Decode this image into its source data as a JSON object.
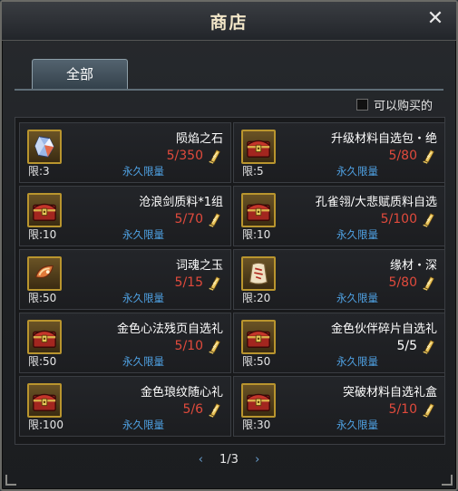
{
  "window": {
    "title": "商店",
    "close_icon": "close-icon"
  },
  "tabs": [
    {
      "label": "全部",
      "active": true
    }
  ],
  "filter": {
    "label": "可以购买的",
    "checked": false
  },
  "items": [
    {
      "name": "陨焰之石",
      "price": "5/350",
      "limit": "限:3",
      "tag": "永久限量",
      "icon": "crystal-icon",
      "affordable": false
    },
    {
      "name": "升级材料自选包・绝",
      "price": "5/80",
      "limit": "限:5",
      "tag": "永久限量",
      "icon": "chest-icon",
      "affordable": false
    },
    {
      "name": "沧浪剑质料*1组",
      "price": "5/70",
      "limit": "限:10",
      "tag": "永久限量",
      "icon": "chest-icon",
      "affordable": false
    },
    {
      "name": "孔雀翎/大悲赋质料自选",
      "price": "5/100",
      "limit": "限:10",
      "tag": "永久限量",
      "icon": "chest-icon",
      "affordable": false
    },
    {
      "name": "词魂之玉",
      "price": "5/15",
      "limit": "限:50",
      "tag": "永久限量",
      "icon": "jade-icon",
      "affordable": false
    },
    {
      "name": "缘材・深",
      "price": "5/80",
      "limit": "限:20",
      "tag": "永久限量",
      "icon": "talisman-icon",
      "affordable": false
    },
    {
      "name": "金色心法残页自选礼",
      "price": "5/10",
      "limit": "限:50",
      "tag": "永久限量",
      "icon": "chest-icon",
      "affordable": false
    },
    {
      "name": "金色伙伴碎片自选礼",
      "price": "5/5",
      "limit": "限:50",
      "tag": "永久限量",
      "icon": "chest-icon",
      "affordable": true
    },
    {
      "name": "金色琅纹随心礼",
      "price": "5/6",
      "limit": "限:100",
      "tag": "永久限量",
      "icon": "chest-icon",
      "affordable": false
    },
    {
      "name": "突破材料自选礼盒",
      "price": "5/10",
      "limit": "限:30",
      "tag": "永久限量",
      "icon": "chest-icon",
      "affordable": false
    }
  ],
  "currency_icon": "scroll-token-icon",
  "pagination": {
    "current": "1/3",
    "prev_icon": "chevron-left-icon",
    "next_icon": "chevron-right-icon"
  },
  "colors": {
    "price_insufficient": "#e04a3c",
    "price_ok": "#ffffff",
    "permanent_tag": "#4fa2e4",
    "icon_border": "#b9952e"
  }
}
